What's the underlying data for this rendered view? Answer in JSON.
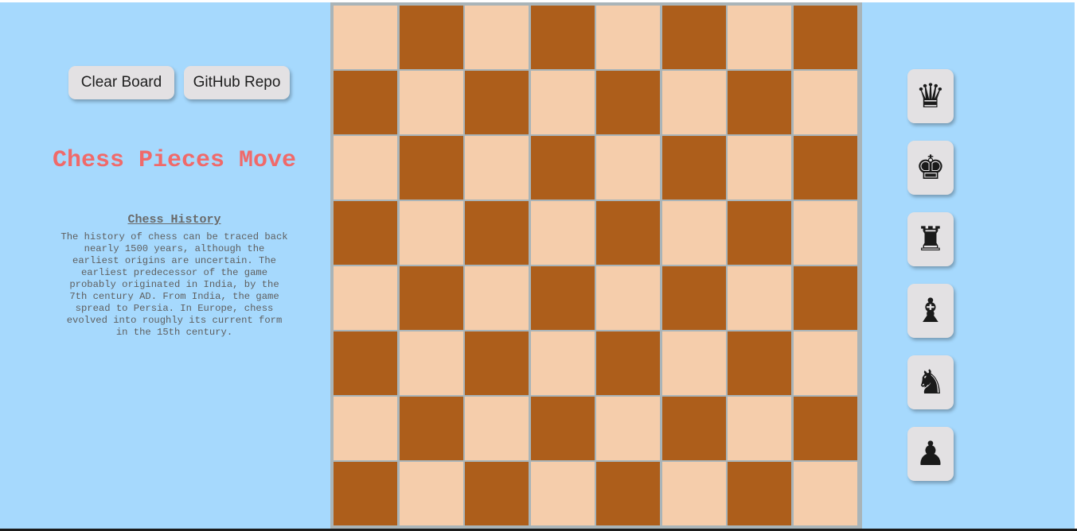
{
  "controls": {
    "clear_board_label": "Clear Board",
    "github_repo_label": "GitHub Repo"
  },
  "title": "Chess Pieces Move",
  "history": {
    "heading": "Chess History",
    "text": "The history of chess can be traced back nearly 1500 years, although the earliest origins are uncertain. The earliest predecessor of the game probably originated in India, by the 7th century AD. From India, the game spread to Persia. In Europe, chess evolved into roughly its current form in the 15th century."
  },
  "board": {
    "rows": 8,
    "cols": 8,
    "light_color": "#f5cdab",
    "dark_color": "#ad5e1b",
    "top_left_square": "light"
  },
  "pieces": [
    {
      "name": "queen",
      "glyph": "♛",
      "icon": "queen-icon"
    },
    {
      "name": "king",
      "glyph": "♚",
      "icon": "king-icon"
    },
    {
      "name": "rook",
      "glyph": "♜",
      "icon": "rook-icon"
    },
    {
      "name": "bishop",
      "glyph": "♝",
      "icon": "bishop-icon"
    },
    {
      "name": "knight",
      "glyph": "♞",
      "icon": "knight-icon"
    },
    {
      "name": "pawn",
      "glyph": "♟",
      "icon": "pawn-icon"
    }
  ],
  "colors": {
    "background": "#a6d9fd",
    "title": "#f06a6a",
    "button": "#e3e1e3"
  }
}
